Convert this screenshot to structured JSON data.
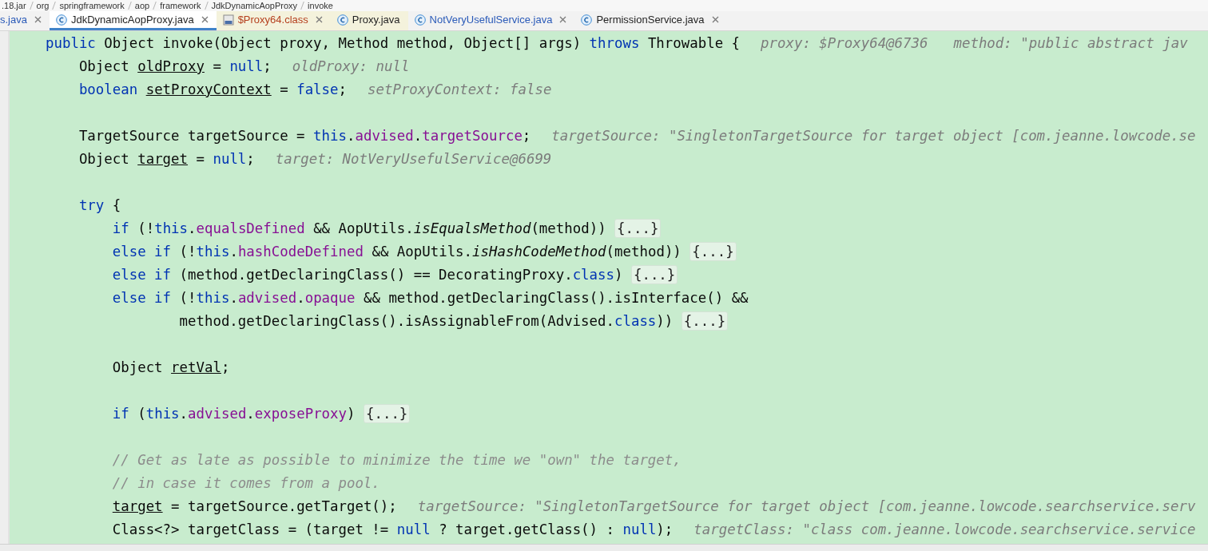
{
  "breadcrumb": [
    ".18.jar",
    "org",
    "springframework",
    "aop",
    "framework",
    "JdkDynamicAopProxy",
    "invoke"
  ],
  "tabs": [
    {
      "label": "s.java",
      "kind": "clipped",
      "color": "#2a5ab8",
      "selected": false,
      "closable": true
    },
    {
      "label": "JdkDynamicAopProxy.java",
      "kind": "source",
      "color": "#1f1f1f",
      "selected": true,
      "closable": true
    },
    {
      "label": "$Proxy64.class",
      "kind": "library-binary",
      "color": "#b5401f",
      "selected": false,
      "closable": true
    },
    {
      "label": "Proxy.java",
      "kind": "library-source",
      "color": "#1f1f1f",
      "selected": false,
      "closable": false
    },
    {
      "label": "NotVeryUsefulService.java",
      "kind": "source",
      "color": "#2a5ab8",
      "selected": false,
      "closable": true
    },
    {
      "label": "PermissionService.java",
      "kind": "source",
      "color": "#1f1f1f",
      "selected": false,
      "closable": true
    }
  ],
  "code": [
    {
      "kind": "code",
      "tokens": [
        {
          "kind": "kw",
          "text": "public"
        },
        {
          "kind": "plain",
          "text": " Object invoke(Object proxy, Method method, Object[] args) "
        },
        {
          "kind": "kw",
          "text": "throws"
        },
        {
          "kind": "plain",
          "text": " Throwable {"
        }
      ],
      "hints": [
        "proxy: $Proxy64@6736",
        "method: \"public abstract jav"
      ]
    },
    {
      "kind": "code",
      "tokens": [
        {
          "kind": "plain",
          "text": "    Object "
        },
        {
          "kind": "local",
          "text": "oldProxy"
        },
        {
          "kind": "plain",
          "text": " = "
        },
        {
          "kind": "kw",
          "text": "null"
        },
        {
          "kind": "plain",
          "text": ";"
        }
      ],
      "hints": [
        "oldProxy: null"
      ]
    },
    {
      "kind": "code",
      "tokens": [
        {
          "kind": "kw",
          "text": "    boolean"
        },
        {
          "kind": "local",
          "text": " setProxyContext"
        },
        {
          "kind": "plain",
          "text": " = "
        },
        {
          "kind": "kw",
          "text": "false"
        },
        {
          "kind": "plain",
          "text": ";"
        }
      ],
      "hints": [
        "setProxyContext: false"
      ]
    },
    {
      "kind": "blank"
    },
    {
      "kind": "code",
      "tokens": [
        {
          "kind": "plain",
          "text": "    TargetSource targetSource = "
        },
        {
          "kind": "kw",
          "text": "this"
        },
        {
          "kind": "plain",
          "text": "."
        },
        {
          "kind": "field",
          "text": "advised"
        },
        {
          "kind": "plain",
          "text": "."
        },
        {
          "kind": "field",
          "text": "targetSource"
        },
        {
          "kind": "plain",
          "text": ";"
        }
      ],
      "hints": [
        "targetSource: \"SingletonTargetSource for target object [com.jeanne.lowcode.se"
      ]
    },
    {
      "kind": "code",
      "tokens": [
        {
          "kind": "plain",
          "text": "    Object "
        },
        {
          "kind": "local",
          "text": "target"
        },
        {
          "kind": "plain",
          "text": " = "
        },
        {
          "kind": "kw",
          "text": "null"
        },
        {
          "kind": "plain",
          "text": ";"
        }
      ],
      "hints": [
        "target: NotVeryUsefulService@6699"
      ]
    },
    {
      "kind": "blank"
    },
    {
      "kind": "code",
      "tokens": [
        {
          "kind": "kw",
          "text": "    try"
        },
        {
          "kind": "plain",
          "text": " {"
        }
      ]
    },
    {
      "kind": "code",
      "tokens": [
        {
          "kind": "kw",
          "text": "        if"
        },
        {
          "kind": "plain",
          "text": " (!"
        },
        {
          "kind": "kw",
          "text": "this"
        },
        {
          "kind": "plain",
          "text": "."
        },
        {
          "kind": "field",
          "text": "equalsDefined"
        },
        {
          "kind": "plain",
          "text": " && AopUtils."
        },
        {
          "kind": "static",
          "text": "isEqualsMethod"
        },
        {
          "kind": "plain",
          "text": "(method)) "
        }
      ],
      "fold": "{...}"
    },
    {
      "kind": "code",
      "tokens": [
        {
          "kind": "kw",
          "text": "        else if"
        },
        {
          "kind": "plain",
          "text": " (!"
        },
        {
          "kind": "kw",
          "text": "this"
        },
        {
          "kind": "plain",
          "text": "."
        },
        {
          "kind": "field",
          "text": "hashCodeDefined"
        },
        {
          "kind": "plain",
          "text": " && AopUtils."
        },
        {
          "kind": "static",
          "text": "isHashCodeMethod"
        },
        {
          "kind": "plain",
          "text": "(method)) "
        }
      ],
      "fold": "{...}"
    },
    {
      "kind": "code",
      "tokens": [
        {
          "kind": "kw",
          "text": "        else if"
        },
        {
          "kind": "plain",
          "text": " (method.getDeclaringClass() == DecoratingProxy."
        },
        {
          "kind": "kw",
          "text": "class"
        },
        {
          "kind": "plain",
          "text": ") "
        }
      ],
      "fold": "{...}"
    },
    {
      "kind": "code",
      "tokens": [
        {
          "kind": "kw",
          "text": "        else if"
        },
        {
          "kind": "plain",
          "text": " (!"
        },
        {
          "kind": "kw",
          "text": "this"
        },
        {
          "kind": "plain",
          "text": "."
        },
        {
          "kind": "field",
          "text": "advised"
        },
        {
          "kind": "plain",
          "text": "."
        },
        {
          "kind": "field",
          "text": "opaque"
        },
        {
          "kind": "plain",
          "text": " && method.getDeclaringClass().isInterface() &&"
        }
      ]
    },
    {
      "kind": "code",
      "tokens": [
        {
          "kind": "plain",
          "text": "                method.getDeclaringClass().isAssignableFrom(Advised."
        },
        {
          "kind": "kw",
          "text": "class"
        },
        {
          "kind": "plain",
          "text": ")) "
        }
      ],
      "fold": "{...}"
    },
    {
      "kind": "blank"
    },
    {
      "kind": "code",
      "tokens": [
        {
          "kind": "plain",
          "text": "        Object "
        },
        {
          "kind": "local",
          "text": "retVal"
        },
        {
          "kind": "plain",
          "text": ";"
        }
      ]
    },
    {
      "kind": "blank"
    },
    {
      "kind": "code",
      "tokens": [
        {
          "kind": "kw",
          "text": "        if"
        },
        {
          "kind": "plain",
          "text": " ("
        },
        {
          "kind": "kw",
          "text": "this"
        },
        {
          "kind": "plain",
          "text": "."
        },
        {
          "kind": "field",
          "text": "advised"
        },
        {
          "kind": "plain",
          "text": "."
        },
        {
          "kind": "field",
          "text": "exposeProxy"
        },
        {
          "kind": "plain",
          "text": ") "
        }
      ],
      "fold": "{...}"
    },
    {
      "kind": "blank"
    },
    {
      "kind": "code",
      "tokens": [
        {
          "kind": "comment",
          "text": "        // Get as late as possible to minimize the time we \"own\" the target,"
        }
      ]
    },
    {
      "kind": "code",
      "tokens": [
        {
          "kind": "comment",
          "text": "        // in case it comes from a pool."
        }
      ]
    },
    {
      "kind": "code",
      "tokens": [
        {
          "kind": "local",
          "text": "        target"
        },
        {
          "kind": "plain",
          "text": " = targetSource.getTarget();"
        }
      ],
      "hints": [
        "targetSource: \"SingletonTargetSource for target object [com.jeanne.lowcode.searchservice.serv"
      ]
    },
    {
      "kind": "code",
      "tokens": [
        {
          "kind": "plain",
          "text": "        Class<?> targetClass = (target != "
        },
        {
          "kind": "kw",
          "text": "null"
        },
        {
          "kind": "plain",
          "text": " ? target.getClass() : "
        },
        {
          "kind": "kw",
          "text": "null"
        },
        {
          "kind": "plain",
          "text": ");"
        }
      ],
      "hints": [
        "targetClass: \"class com.jeanne.lowcode.searchservice.service"
      ]
    }
  ]
}
